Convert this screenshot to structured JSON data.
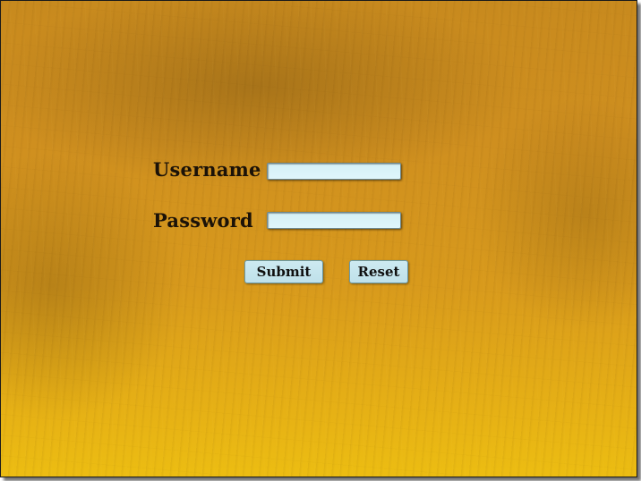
{
  "login_form": {
    "username_label": "Username",
    "username_value": "",
    "password_label": "Password",
    "password_value": "",
    "submit_label": "Submit",
    "reset_label": "Reset"
  },
  "colors": {
    "background_top": "#c88a1e",
    "background_bottom": "#ecbd12",
    "field_fill": "#d4f0f6",
    "button_fill": "#cdeaf1",
    "label_text": "#1b1208"
  }
}
